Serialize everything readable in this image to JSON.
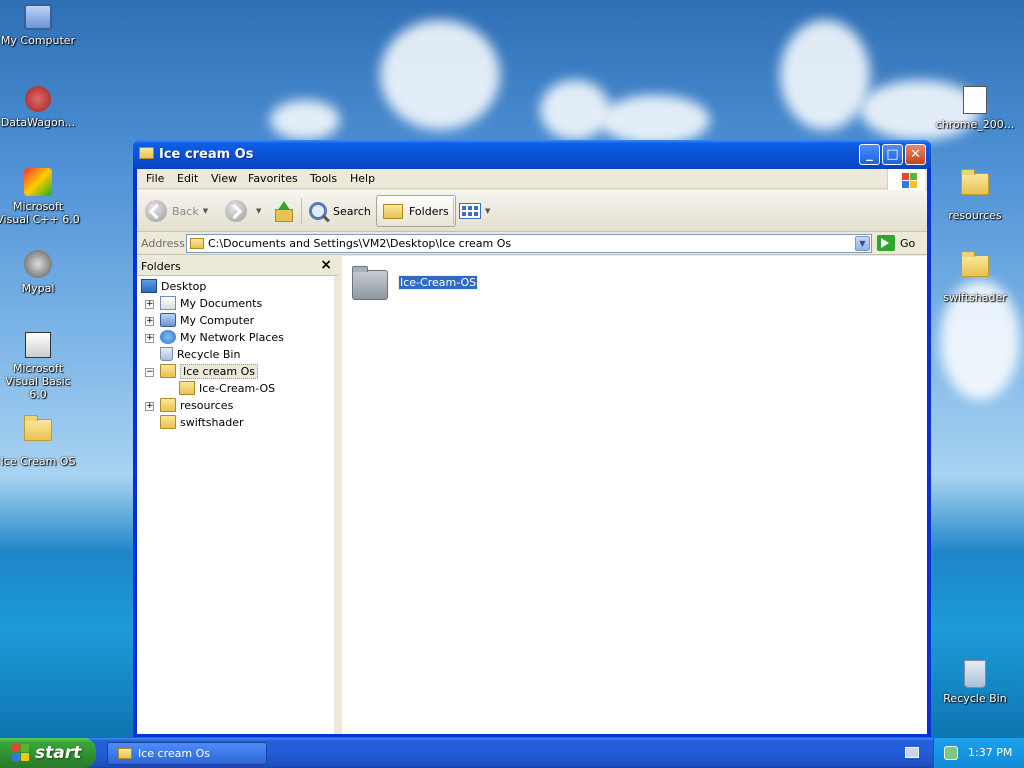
{
  "desktop": {
    "icons_left": [
      {
        "label": "My Computer"
      },
      {
        "label": "DataWagon..."
      },
      {
        "label": "Microsoft Visual C++ 6.0"
      },
      {
        "label": "Mypal"
      },
      {
        "label": "Microsoft Visual Basic 6.0"
      },
      {
        "label": "Ice Cream OS"
      }
    ],
    "icons_right": [
      {
        "label": "chrome_200..."
      },
      {
        "label": "resources"
      },
      {
        "label": "swiftshader"
      },
      {
        "label": "Recycle Bin"
      }
    ]
  },
  "window": {
    "title": "Ice cream Os",
    "menu": [
      "File",
      "Edit",
      "View",
      "Favorites",
      "Tools",
      "Help"
    ],
    "toolbar": {
      "back": "Back",
      "search": "Search",
      "folders": "Folders"
    },
    "address": {
      "label": "Address",
      "path": "C:\\Documents and Settings\\VM2\\Desktop\\Ice cream Os",
      "go": "Go"
    },
    "folders_pane": {
      "title": "Folders",
      "close": "×",
      "tree": [
        {
          "label": "Desktop",
          "icon": "desktop-icon"
        },
        {
          "label": "My Documents",
          "icon": "my-documents-icon"
        },
        {
          "label": "My Computer",
          "icon": "my-computer-icon"
        },
        {
          "label": "My Network Places",
          "icon": "network-places-icon"
        },
        {
          "label": "Recycle Bin",
          "icon": "recycle-bin-icon"
        },
        {
          "label": "Ice cream Os",
          "icon": "folder-icon"
        },
        {
          "label": "Ice-Cream-OS",
          "icon": "folder-icon"
        },
        {
          "label": "resources",
          "icon": "folder-icon"
        },
        {
          "label": "swiftshader",
          "icon": "folder-icon"
        }
      ]
    },
    "content": {
      "items": [
        {
          "label": "Ice-Cream-OS",
          "selected": true
        }
      ]
    }
  },
  "taskbar": {
    "start": "start",
    "task": "Ice cream Os",
    "clock": "1:37 PM"
  },
  "colors": {
    "title_blue": "#0a53d6",
    "start_green": "#3aa63a",
    "selection": "#316ac5"
  }
}
